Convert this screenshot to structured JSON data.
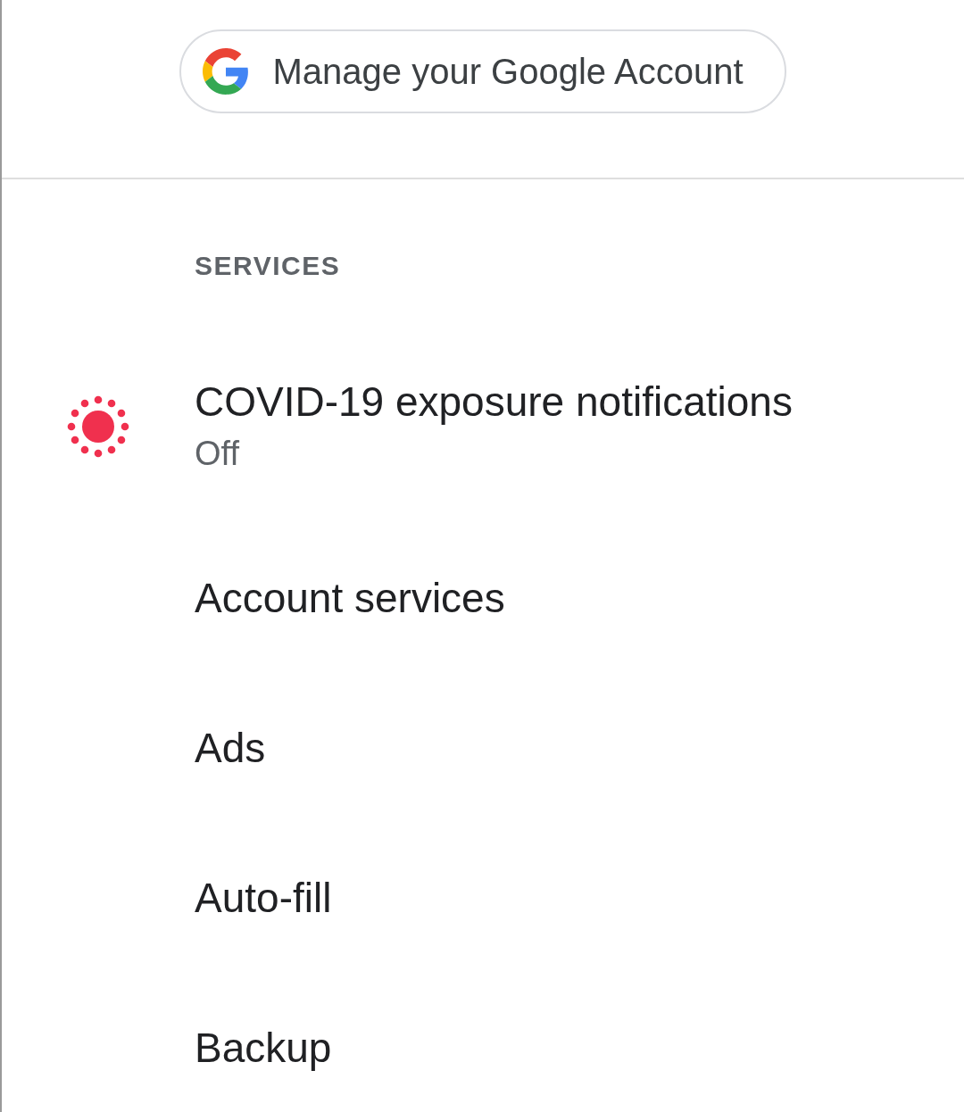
{
  "account_button": {
    "label": "Manage your Google Account"
  },
  "section": {
    "title": "SERVICES"
  },
  "items": [
    {
      "kind": "exposure",
      "title": "COVID-19 exposure notifications",
      "subtitle": "Off"
    },
    {
      "kind": "plain",
      "title": "Account services"
    },
    {
      "kind": "plain",
      "title": "Ads"
    },
    {
      "kind": "plain",
      "title": "Auto-fill"
    },
    {
      "kind": "plain",
      "title": "Backup"
    }
  ]
}
